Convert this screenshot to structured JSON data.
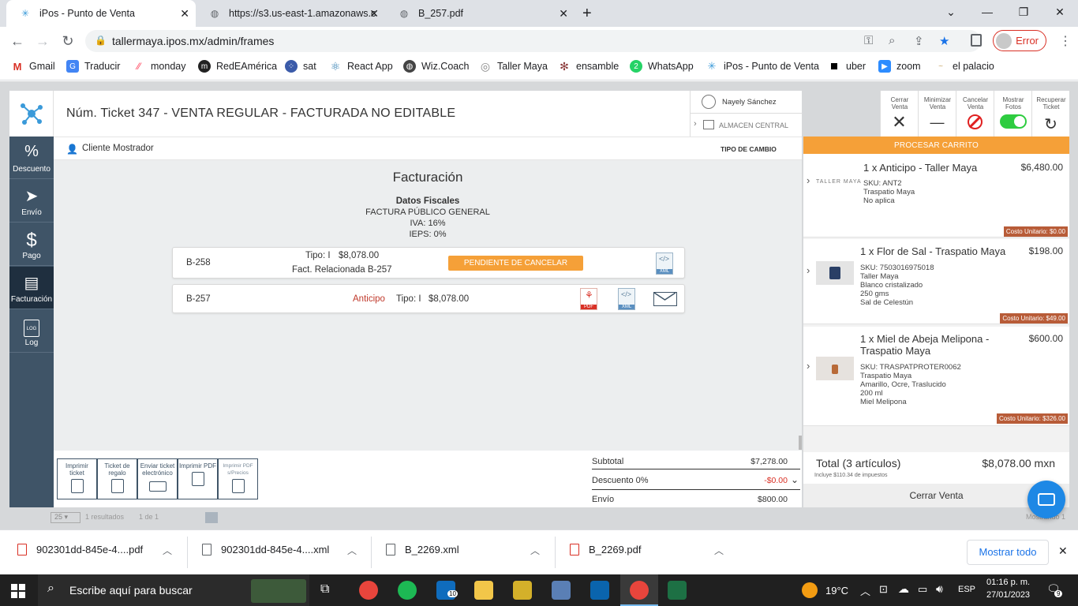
{
  "browser": {
    "tabs": [
      {
        "label": "iPos - Punto de Venta",
        "active": true
      },
      {
        "label": "https://s3.us-east-1.amazonaws.c",
        "active": false
      },
      {
        "label": "B_257.pdf",
        "active": false
      }
    ],
    "url": "tallermaya.ipos.mx/admin/frames",
    "error_label": "Error",
    "bookmarks": [
      "Gmail",
      "Traducir",
      "monday",
      "RedEAmérica",
      "sat",
      "React App",
      "Wiz.Coach",
      "Taller Maya",
      "ensamble",
      "WhatsApp",
      "iPos - Punto de Venta",
      "uber",
      "zoom",
      "el palacio"
    ]
  },
  "app": {
    "title": "Núm. Ticket 347 - VENTA REGULAR - FACTURADA NO EDITABLE",
    "user_name": "Nayely Sánchez",
    "warehouse": "ALMACEN CENTRAL",
    "client": "Cliente Mostrador",
    "exchange_label": "TIPO DE CAMBIO",
    "actions": [
      {
        "label": "Cerrar Venta"
      },
      {
        "label": "Minimizar Venta"
      },
      {
        "label": "Cancelar Venta"
      },
      {
        "label": "Mostrar Fotos"
      },
      {
        "label": "Recuperar Ticket"
      }
    ],
    "sidebar": [
      {
        "label": "Descuento",
        "icon": "%"
      },
      {
        "label": "Envío",
        "icon": "➤"
      },
      {
        "label": "Pago",
        "icon": "$"
      },
      {
        "label": "Facturación",
        "icon": "▤"
      },
      {
        "label": "Log",
        "icon": "LOG"
      }
    ],
    "facturacion": {
      "heading": "Facturación",
      "fiscal_title": "Datos Fiscales",
      "fiscal_lines": [
        "FACTURA PÚBLICO GENERAL",
        "IVA: 16%",
        "IEPS: 0%"
      ],
      "invoices": [
        {
          "id": "B-258",
          "tipo": "Tipo: I",
          "amount": "$8,078.00",
          "related": "Fact. Relacionada B-257",
          "status": "PENDIENTE DE CANCELAR"
        },
        {
          "id": "B-257",
          "type_label": "Anticipo",
          "tipo": "Tipo: I",
          "amount": "$8,078.00"
        }
      ],
      "xml_label": "XML",
      "pdf_label": "PDF"
    },
    "print_buttons": [
      "Imprimir ticket",
      "Ticket de regalo",
      "Enviar ticket electrónico",
      "Imprimir PDF",
      "Imprimir PDF s/Precios"
    ],
    "summary": {
      "subtotal_label": "Subtotal",
      "subtotal": "$7,278.00",
      "discount_label": "Descuento 0%",
      "discount": "-$0.00",
      "shipping_label": "Envío",
      "shipping": "$800.00"
    },
    "cart": {
      "process_label": "PROCESAR CARRITO",
      "items": [
        {
          "title": "1 x Anticipo - Taller Maya",
          "price": "$6,480.00",
          "lines": [
            "SKU: ANT2",
            "Traspatio Maya",
            "No aplica"
          ],
          "unit": "Costo Unitario: $0.00",
          "brand": "TALLER MAYA"
        },
        {
          "title": "1 x Flor de Sal - Traspatio Maya",
          "price": "$198.00",
          "lines": [
            "SKU: 7503016975018",
            "Taller Maya",
            "Blanco cristalizado",
            "250 gms",
            "Sal de Celestún"
          ],
          "unit": "Costo Unitario: $49.00"
        },
        {
          "title": "1 x Miel de Abeja Melipona - Traspatio Maya",
          "price": "$600.00",
          "lines": [
            "SKU: TRASPATPROTER0062",
            "Traspatio Maya",
            "Amarillo, Ocre, Traslucido",
            "200 ml",
            "Miel Melipona"
          ],
          "unit": "Costo Unitario: $326.00"
        }
      ],
      "total_label": "Total (3 artículos)",
      "total": "$8,078.00 mxn",
      "tax_note": "Incluye $110.34 de impuestos",
      "close_label": "Cerrar Venta"
    },
    "background": {
      "pagination": [
        "25",
        "1 resultados",
        "1 de 1"
      ],
      "showing": "Mostrando 1"
    }
  },
  "downloads": {
    "files": [
      {
        "name": "902301dd-845e-4....pdf",
        "type": "pdf"
      },
      {
        "name": "902301dd-845e-4....xml",
        "type": "xml"
      },
      {
        "name": "B_2269.xml",
        "type": "xml"
      },
      {
        "name": "B_2269.pdf",
        "type": "pdf"
      }
    ],
    "show_all": "Mostrar todo"
  },
  "taskbar": {
    "search_placeholder": "Escribe aquí para buscar",
    "weather": "19°C",
    "lang": "ESP",
    "time": "01:16 p. m.",
    "date": "27/01/2023",
    "mail_badge": "10",
    "notif_badge": "9"
  },
  "colors": {
    "accent": "#f5a038",
    "sidebar": "#3f5467",
    "danger": "#d93025",
    "toggle": "#2ecc40"
  }
}
